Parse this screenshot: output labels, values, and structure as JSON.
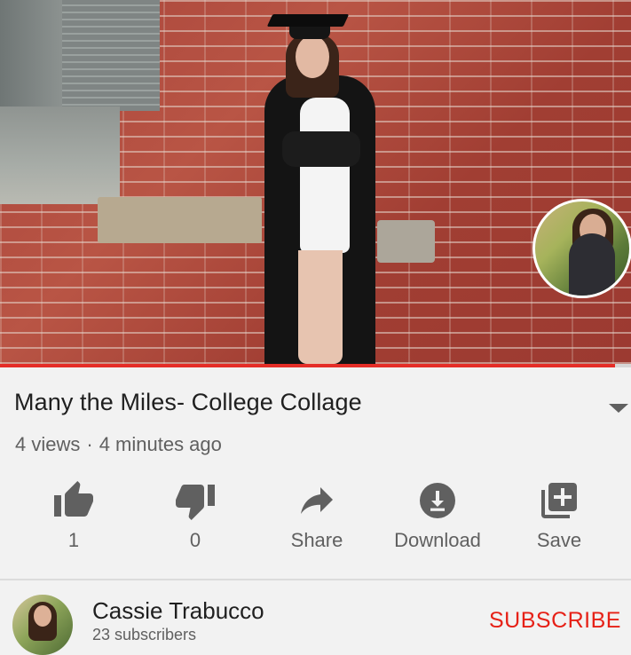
{
  "video": {
    "progress_percent": 97.5,
    "progress_color": "#e52d27"
  },
  "info": {
    "title": "Many the Miles- College Collage",
    "views": "4 views",
    "separator": "·",
    "age": "4 minutes ago"
  },
  "actions": [
    {
      "label": "1",
      "icon": "thumbs-up-icon"
    },
    {
      "label": "0",
      "icon": "thumbs-down-icon"
    },
    {
      "label": "Share",
      "icon": "share-icon"
    },
    {
      "label": "Download",
      "icon": "download-icon"
    },
    {
      "label": "Save",
      "icon": "playlist-add-icon"
    }
  ],
  "channel": {
    "name": "Cassie Trabucco",
    "subscribers": "23 subscribers",
    "subscribe_label": "SUBSCRIBE",
    "subscribe_color": "#e62117"
  },
  "colors": {
    "icon": "#606060",
    "text_secondary": "#606060"
  }
}
